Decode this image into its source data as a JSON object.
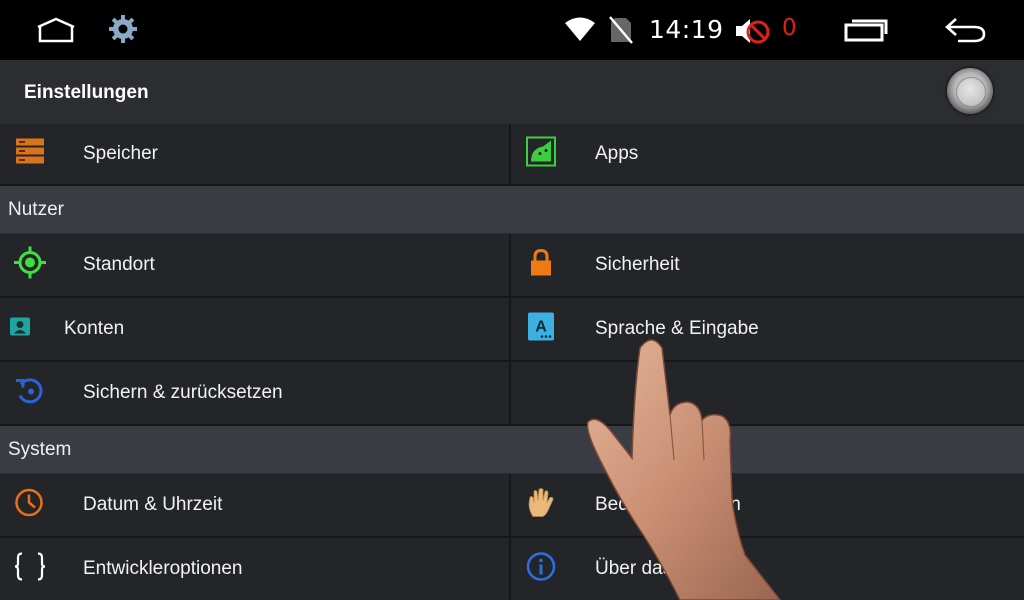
{
  "status_bar": {
    "time": "14:19",
    "notification_count": "0",
    "icons": [
      "home-icon",
      "settings-gear-icon",
      "wifi-icon",
      "no-sim-icon",
      "mute-icon",
      "recent-apps-icon",
      "back-icon"
    ]
  },
  "header": {
    "title": "Einstellungen",
    "action_icon": "search-orb-icon"
  },
  "settings": {
    "rows_top": [
      {
        "label": "Speicher",
        "icon": "storage-icon",
        "color": "#d9741c"
      },
      {
        "label": "Apps",
        "icon": "android-icon",
        "color": "#3ccf3c"
      }
    ],
    "sections": [
      {
        "label": "Nutzer",
        "items": [
          {
            "label": "Standort",
            "icon": "location-icon",
            "color": "#3ee03e"
          },
          {
            "label": "Sicherheit",
            "icon": "lock-icon",
            "color": "#ee7a16"
          },
          {
            "label": "Konten",
            "icon": "account-icon",
            "color": "#1fa5a0"
          },
          {
            "label": "Sprache & Eingabe",
            "icon": "language-icon",
            "color": "#3cb0e0"
          },
          {
            "label": "Sichern & zurücksetzen",
            "icon": "backup-restore-icon",
            "color": "#2a63d6"
          }
        ]
      },
      {
        "label": "System",
        "items": [
          {
            "label": "Datum & Uhrzeit",
            "icon": "clock-icon",
            "color": "#e8701a"
          },
          {
            "label": "Bedienungshilfen",
            "icon": "hand-icon",
            "color": "#e8b97a"
          },
          {
            "label": "Entwickleroptionen",
            "icon": "braces-icon",
            "color": "#ffffff"
          },
          {
            "label": "Über das Gerät",
            "icon": "info-icon",
            "color": "#2b6fe0"
          }
        ]
      }
    ]
  }
}
